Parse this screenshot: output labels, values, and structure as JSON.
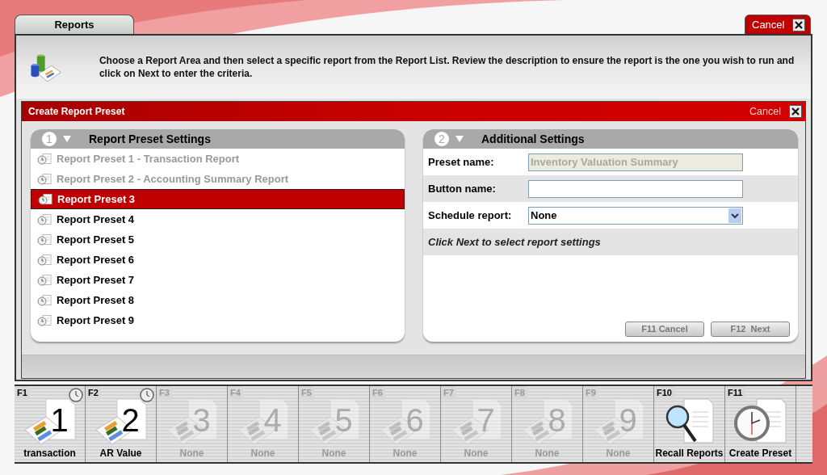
{
  "window": {
    "tab": {
      "label": "Reports",
      "selected": true
    },
    "cancel_button": "Cancel",
    "instructions": "Choose a Report Area and then select a specific report from the Report List. Review the description to ensure the report is the one you wish to run and click on Next to enter the criteria."
  },
  "dialog": {
    "title": "Create Report Preset",
    "cancel_button": "Cancel",
    "presets_panel": {
      "number": "1",
      "title": "Report Preset Settings",
      "items": [
        {
          "label": "Report Preset 1 - Transaction Report",
          "disabled": true,
          "selected": false
        },
        {
          "label": "Report Preset 2 - Accounting Summary Report",
          "disabled": true,
          "selected": false
        },
        {
          "label": "Report Preset 3",
          "disabled": false,
          "selected": true
        },
        {
          "label": "Report Preset 4",
          "disabled": false,
          "selected": false
        },
        {
          "label": "Report Preset 5",
          "disabled": false,
          "selected": false
        },
        {
          "label": "Report Preset 6",
          "disabled": false,
          "selected": false
        },
        {
          "label": "Report Preset 7",
          "disabled": false,
          "selected": false
        },
        {
          "label": "Report Preset 8",
          "disabled": false,
          "selected": false
        },
        {
          "label": "Report Preset 9",
          "disabled": false,
          "selected": false
        }
      ]
    },
    "settings_panel": {
      "number": "2",
      "title": "Additional Settings",
      "fields": [
        {
          "kind": "text",
          "label": "Preset name:",
          "value": "Inventory Valuation Summary",
          "disabled": true
        },
        {
          "kind": "text",
          "label": "Button name:",
          "disabled": false
        },
        {
          "kind": "select",
          "label": "Schedule report:",
          "value": "None"
        }
      ],
      "hint": "Click Next to select report settings",
      "buttons": [
        {
          "label": "F11 Cancel",
          "disabled": true
        },
        {
          "label": "F12  Next",
          "disabled": true
        }
      ]
    }
  },
  "function_bar": [
    {
      "kind": "preset",
      "key": "F1",
      "number": "1",
      "caption": "transaction",
      "disabled": false,
      "scheduled": true
    },
    {
      "kind": "preset",
      "key": "F2",
      "number": "2",
      "caption": "AR Value",
      "disabled": false,
      "scheduled": true
    },
    {
      "kind": "preset",
      "key": "F3",
      "number": "3",
      "caption": "None",
      "disabled": true,
      "scheduled": false
    },
    {
      "kind": "preset",
      "key": "F4",
      "number": "4",
      "caption": "None",
      "disabled": true,
      "scheduled": false
    },
    {
      "kind": "preset",
      "key": "F5",
      "number": "5",
      "caption": "None",
      "disabled": true,
      "scheduled": false
    },
    {
      "kind": "preset",
      "key": "F6",
      "number": "6",
      "caption": "None",
      "disabled": true,
      "scheduled": false
    },
    {
      "kind": "preset",
      "key": "F7",
      "number": "7",
      "caption": "None",
      "disabled": true,
      "scheduled": false
    },
    {
      "kind": "preset",
      "key": "F8",
      "number": "8",
      "caption": "None",
      "disabled": true,
      "scheduled": false
    },
    {
      "kind": "preset",
      "key": "F9",
      "number": "9",
      "caption": "None",
      "disabled": true,
      "scheduled": false
    },
    {
      "kind": "recall",
      "key": "F10",
      "caption": "Recall Reports",
      "disabled": false
    },
    {
      "kind": "create",
      "key": "F11",
      "caption": "Create Preset",
      "disabled": false
    }
  ]
}
